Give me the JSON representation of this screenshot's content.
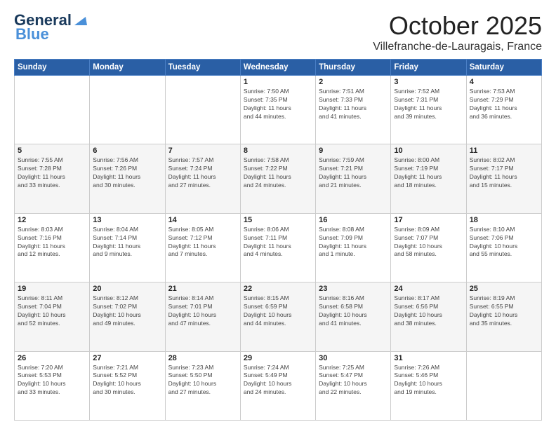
{
  "header": {
    "logo_line1": "General",
    "logo_line2": "Blue",
    "month_title": "October 2025",
    "location": "Villefranche-de-Lauragais, France"
  },
  "days_of_week": [
    "Sunday",
    "Monday",
    "Tuesday",
    "Wednesday",
    "Thursday",
    "Friday",
    "Saturday"
  ],
  "weeks": [
    [
      {
        "day": "",
        "info": ""
      },
      {
        "day": "",
        "info": ""
      },
      {
        "day": "",
        "info": ""
      },
      {
        "day": "1",
        "info": "Sunrise: 7:50 AM\nSunset: 7:35 PM\nDaylight: 11 hours\nand 44 minutes."
      },
      {
        "day": "2",
        "info": "Sunrise: 7:51 AM\nSunset: 7:33 PM\nDaylight: 11 hours\nand 41 minutes."
      },
      {
        "day": "3",
        "info": "Sunrise: 7:52 AM\nSunset: 7:31 PM\nDaylight: 11 hours\nand 39 minutes."
      },
      {
        "day": "4",
        "info": "Sunrise: 7:53 AM\nSunset: 7:29 PM\nDaylight: 11 hours\nand 36 minutes."
      }
    ],
    [
      {
        "day": "5",
        "info": "Sunrise: 7:55 AM\nSunset: 7:28 PM\nDaylight: 11 hours\nand 33 minutes."
      },
      {
        "day": "6",
        "info": "Sunrise: 7:56 AM\nSunset: 7:26 PM\nDaylight: 11 hours\nand 30 minutes."
      },
      {
        "day": "7",
        "info": "Sunrise: 7:57 AM\nSunset: 7:24 PM\nDaylight: 11 hours\nand 27 minutes."
      },
      {
        "day": "8",
        "info": "Sunrise: 7:58 AM\nSunset: 7:22 PM\nDaylight: 11 hours\nand 24 minutes."
      },
      {
        "day": "9",
        "info": "Sunrise: 7:59 AM\nSunset: 7:21 PM\nDaylight: 11 hours\nand 21 minutes."
      },
      {
        "day": "10",
        "info": "Sunrise: 8:00 AM\nSunset: 7:19 PM\nDaylight: 11 hours\nand 18 minutes."
      },
      {
        "day": "11",
        "info": "Sunrise: 8:02 AM\nSunset: 7:17 PM\nDaylight: 11 hours\nand 15 minutes."
      }
    ],
    [
      {
        "day": "12",
        "info": "Sunrise: 8:03 AM\nSunset: 7:16 PM\nDaylight: 11 hours\nand 12 minutes."
      },
      {
        "day": "13",
        "info": "Sunrise: 8:04 AM\nSunset: 7:14 PM\nDaylight: 11 hours\nand 9 minutes."
      },
      {
        "day": "14",
        "info": "Sunrise: 8:05 AM\nSunset: 7:12 PM\nDaylight: 11 hours\nand 7 minutes."
      },
      {
        "day": "15",
        "info": "Sunrise: 8:06 AM\nSunset: 7:11 PM\nDaylight: 11 hours\nand 4 minutes."
      },
      {
        "day": "16",
        "info": "Sunrise: 8:08 AM\nSunset: 7:09 PM\nDaylight: 11 hours\nand 1 minute."
      },
      {
        "day": "17",
        "info": "Sunrise: 8:09 AM\nSunset: 7:07 PM\nDaylight: 10 hours\nand 58 minutes."
      },
      {
        "day": "18",
        "info": "Sunrise: 8:10 AM\nSunset: 7:06 PM\nDaylight: 10 hours\nand 55 minutes."
      }
    ],
    [
      {
        "day": "19",
        "info": "Sunrise: 8:11 AM\nSunset: 7:04 PM\nDaylight: 10 hours\nand 52 minutes."
      },
      {
        "day": "20",
        "info": "Sunrise: 8:12 AM\nSunset: 7:02 PM\nDaylight: 10 hours\nand 49 minutes."
      },
      {
        "day": "21",
        "info": "Sunrise: 8:14 AM\nSunset: 7:01 PM\nDaylight: 10 hours\nand 47 minutes."
      },
      {
        "day": "22",
        "info": "Sunrise: 8:15 AM\nSunset: 6:59 PM\nDaylight: 10 hours\nand 44 minutes."
      },
      {
        "day": "23",
        "info": "Sunrise: 8:16 AM\nSunset: 6:58 PM\nDaylight: 10 hours\nand 41 minutes."
      },
      {
        "day": "24",
        "info": "Sunrise: 8:17 AM\nSunset: 6:56 PM\nDaylight: 10 hours\nand 38 minutes."
      },
      {
        "day": "25",
        "info": "Sunrise: 8:19 AM\nSunset: 6:55 PM\nDaylight: 10 hours\nand 35 minutes."
      }
    ],
    [
      {
        "day": "26",
        "info": "Sunrise: 7:20 AM\nSunset: 5:53 PM\nDaylight: 10 hours\nand 33 minutes."
      },
      {
        "day": "27",
        "info": "Sunrise: 7:21 AM\nSunset: 5:52 PM\nDaylight: 10 hours\nand 30 minutes."
      },
      {
        "day": "28",
        "info": "Sunrise: 7:23 AM\nSunset: 5:50 PM\nDaylight: 10 hours\nand 27 minutes."
      },
      {
        "day": "29",
        "info": "Sunrise: 7:24 AM\nSunset: 5:49 PM\nDaylight: 10 hours\nand 24 minutes."
      },
      {
        "day": "30",
        "info": "Sunrise: 7:25 AM\nSunset: 5:47 PM\nDaylight: 10 hours\nand 22 minutes."
      },
      {
        "day": "31",
        "info": "Sunrise: 7:26 AM\nSunset: 5:46 PM\nDaylight: 10 hours\nand 19 minutes."
      },
      {
        "day": "",
        "info": ""
      }
    ]
  ]
}
